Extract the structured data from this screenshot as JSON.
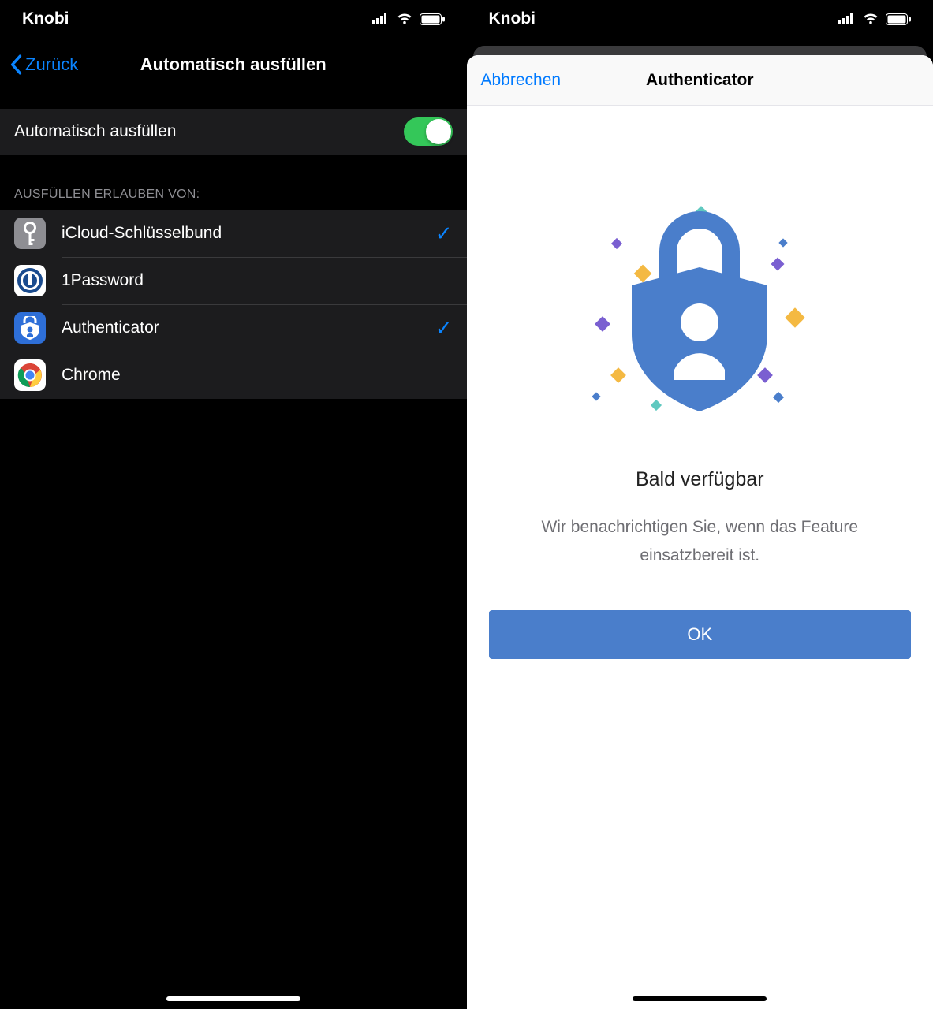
{
  "statusLeft": {
    "carrier": "Knobi"
  },
  "statusRight": {
    "carrier": "Knobi"
  },
  "left": {
    "back": "Zurück",
    "title": "Automatisch ausfüllen",
    "toggle": {
      "label": "Automatisch ausfüllen",
      "on": true
    },
    "sectionHeader": "AUSFÜLLEN ERLAUBEN VON:",
    "providers": [
      {
        "label": "iCloud-Schlüsselbund",
        "checked": true
      },
      {
        "label": "1Password",
        "checked": false
      },
      {
        "label": "Authenticator",
        "checked": true
      },
      {
        "label": "Chrome",
        "checked": false
      }
    ]
  },
  "right": {
    "cancel": "Abbrechen",
    "title": "Authenticator",
    "messageTitle": "Bald verfügbar",
    "messageSub": "Wir benachrichtigen Sie, wenn das Feature einsatzbereit ist.",
    "okLabel": "OK"
  }
}
